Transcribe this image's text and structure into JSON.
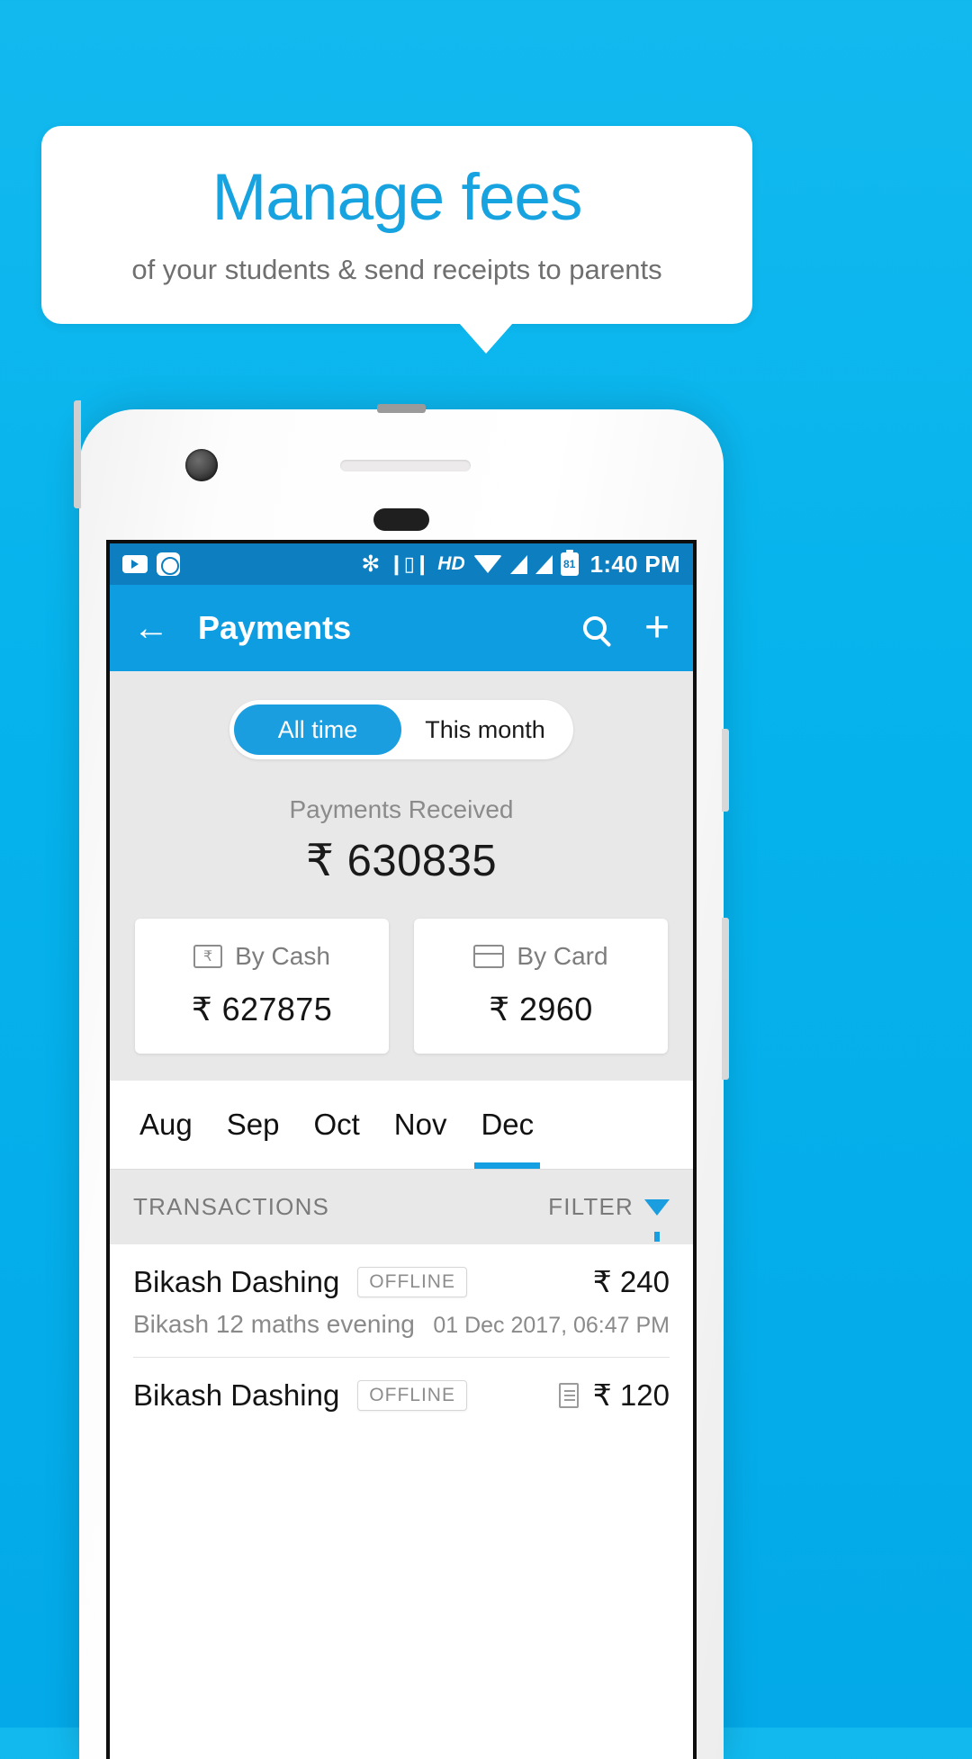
{
  "promo": {
    "title": "Manage fees",
    "subtitle": "of your students & send receipts to parents",
    "title_color": "#17a3e0",
    "background_color": "#06b3ec"
  },
  "statusbar": {
    "icons_left": [
      "youtube-icon",
      "mi-apps-icon"
    ],
    "bluetooth": "✻",
    "vibrate": "vibrate-icon",
    "hd": "HD",
    "wifi": "wifi-icon",
    "signal1": "signal-icon",
    "signal2": "signal-icon",
    "battery_level": "81",
    "time": "1:40 PM"
  },
  "appbar": {
    "back": "←",
    "title": "Payments",
    "search": "search-icon",
    "add": "+",
    "color": "#0d9de0"
  },
  "summary": {
    "segments": [
      {
        "label": "All time",
        "active": true
      },
      {
        "label": "This month",
        "active": false
      }
    ],
    "received_label": "Payments Received",
    "received_amount": "₹ 630835",
    "cards": [
      {
        "icon": "cash-icon",
        "label": "By Cash",
        "amount": "₹ 627875"
      },
      {
        "icon": "card-icon",
        "label": "By Card",
        "amount": "₹ 2960"
      }
    ]
  },
  "months": [
    {
      "label": "Aug",
      "active": false
    },
    {
      "label": "Sep",
      "active": false
    },
    {
      "label": "Oct",
      "active": false
    },
    {
      "label": "Nov",
      "active": false
    },
    {
      "label": "Dec",
      "active": true
    }
  ],
  "transactions_header": {
    "title": "TRANSACTIONS",
    "filter_label": "FILTER",
    "filter_icon": "funnel-icon",
    "filter_color": "#1b9ee0"
  },
  "transactions": [
    {
      "name": "Bikash Dashing",
      "badge": "OFFLINE",
      "amount": "₹ 240",
      "description": "Bikash 12 maths evening",
      "date": "01 Dec 2017, 06:47 PM",
      "has_receipt": false
    },
    {
      "name": "Bikash Dashing",
      "badge": "OFFLINE",
      "amount": "₹ 120",
      "description": "",
      "date": "",
      "has_receipt": true
    }
  ]
}
